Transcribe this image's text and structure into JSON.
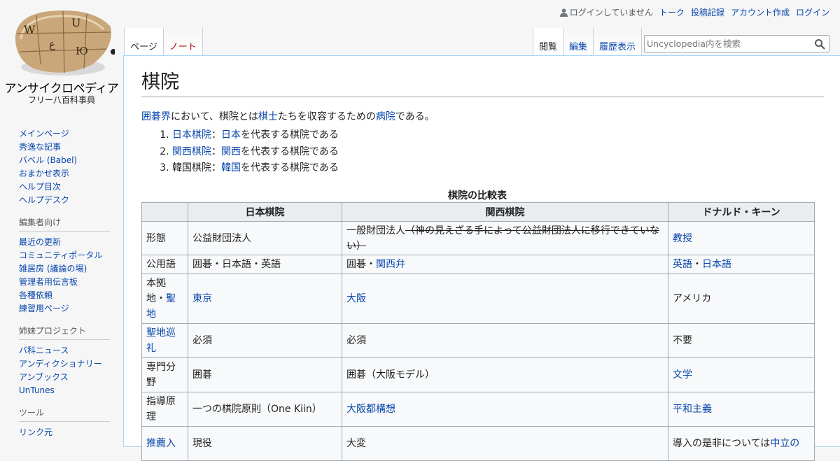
{
  "logo": {
    "site_name": "アンサイクロペディア",
    "tagline": "フリー八百科事典"
  },
  "personal": {
    "anon": "ログインしていません",
    "links": [
      "トーク",
      "投稿記録",
      "アカウント作成",
      "ログイン"
    ]
  },
  "tabs": {
    "left": [
      "ページ",
      "ノート"
    ],
    "right": [
      "閲覧",
      "編集",
      "履歴表示"
    ]
  },
  "search": {
    "placeholder": "Uncyclopedia内を検索"
  },
  "nav": {
    "main": [
      "メインページ",
      "秀逸な記事",
      "バベル (Babel)",
      "おまかせ表示",
      "ヘルプ目次",
      "ヘルプデスク"
    ],
    "editors": {
      "heading": "編集者向け",
      "items": [
        "最近の更新",
        "コミュニティポータル",
        "雑居房 (議論の場)",
        "管理者用伝言板",
        "各種依頼",
        "練習用ページ"
      ]
    },
    "sister": {
      "heading": "姉妹プロジェクト",
      "items": [
        "バ科ニュース",
        "アンディクショナリー",
        "アンブックス",
        "UnTunes"
      ]
    },
    "tools": {
      "heading": "ツール",
      "items": [
        "リンク元"
      ]
    }
  },
  "article": {
    "title": "棋院",
    "intro": {
      "link1": "囲碁界",
      "t1": "において、棋院とは",
      "link2": "棋士",
      "t2": "たちを収容するための",
      "link3": "病院",
      "t3": "である。"
    },
    "list": [
      {
        "a": "日本棋院",
        "sep": "：",
        "b": "日本",
        "rest": "を代表する棋院である"
      },
      {
        "a": "関西棋院",
        "sep": "：",
        "b": "関西",
        "rest": "を代表する棋院である"
      },
      {
        "a": "韓国棋院",
        "sep": "：",
        "b": "韓国",
        "rest": "を代表する棋院である"
      }
    ],
    "table": {
      "caption": "棋院の比較表",
      "headers": [
        "",
        "日本棋院",
        "関西棋院",
        "ドナルド・キーン"
      ],
      "rows": {
        "r1": {
          "label": "形態",
          "c1": "公益財団法人",
          "c2a": "一般財団法人",
          "c2b": "（神の見えざる手によって公益財団法人に移行できていない）",
          "c3": "教授"
        },
        "r2": {
          "label": "公用語",
          "c1": "囲碁・日本語・英語",
          "c2a": "囲碁・",
          "c2b": "関西弁",
          "c3a": "英語",
          "c3sep": "・",
          "c3b": "日本語"
        },
        "r3": {
          "label_a": "本拠地・",
          "label_b": "聖地",
          "c1": "東京",
          "c2": "大阪",
          "c3": "アメリカ"
        },
        "r4": {
          "label": "聖地巡礼",
          "c1": "必須",
          "c2": "必須",
          "c3": "不要"
        },
        "r5": {
          "label": "専門分野",
          "c1": "囲碁",
          "c2": "囲碁（大阪モデル）",
          "c3": "文学"
        },
        "r6": {
          "label": "指導原理",
          "c1": "一つの棋院原則（One Kiin）",
          "c2": "大阪都構想",
          "c3": "平和主義"
        },
        "r7": {
          "label": "推薦入",
          "c1": "現役",
          "c2": "大変",
          "c3a": "導入の是非については",
          "c3b": "中立の"
        }
      }
    }
  }
}
